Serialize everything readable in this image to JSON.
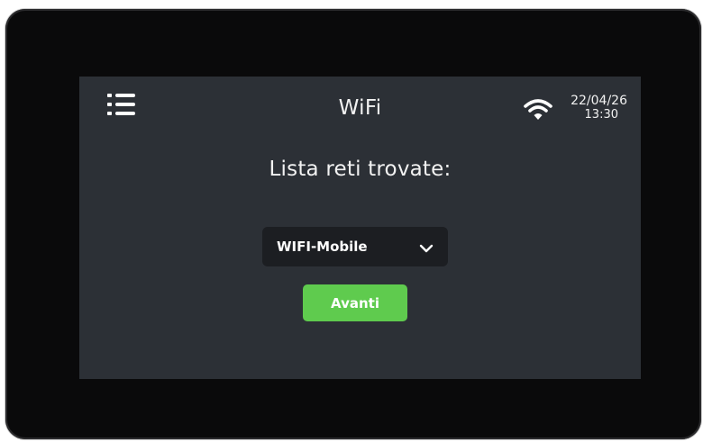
{
  "header": {
    "menu_icon": "menu-list-icon",
    "title": "WiFi",
    "wifi_icon": "wifi-signal-icon",
    "date": "22/04/26",
    "time": "13:30"
  },
  "main": {
    "subtitle": "Lista reti trovate:",
    "network_select": {
      "selected": "WIFI-Mobile",
      "chevron_icon": "chevron-down-icon"
    },
    "next_button": {
      "label": "Avanti"
    }
  },
  "colors": {
    "screen_background": "#2c3036",
    "select_background": "#1c1e22",
    "button_accent": "#5fcb4e",
    "text": "#f2f2f2"
  }
}
